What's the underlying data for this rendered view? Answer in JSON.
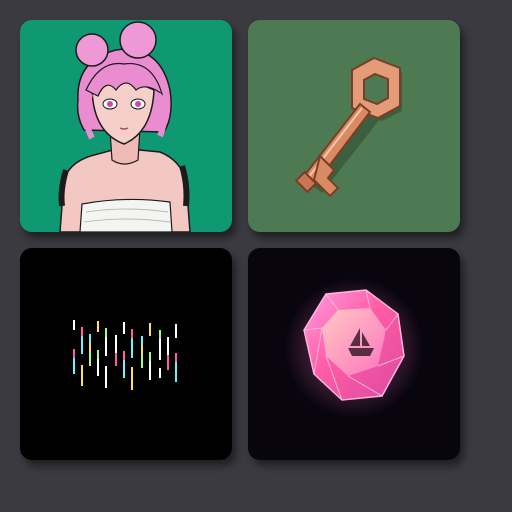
{
  "gallery": {
    "items": [
      {
        "id": "tile-1",
        "icon": "anime-girl-portrait-icon",
        "background": "#0f9972"
      },
      {
        "id": "tile-2",
        "icon": "bronze-key-icon",
        "background": "#4d7a52"
      },
      {
        "id": "tile-3",
        "icon": "glitch-lines-icon",
        "background": "#000000"
      },
      {
        "id": "tile-4",
        "icon": "pink-gem-icon",
        "background": "#08050f"
      }
    ]
  },
  "colors": {
    "page_background": "#3a3a40",
    "accent_pink": "#f08fcf"
  }
}
